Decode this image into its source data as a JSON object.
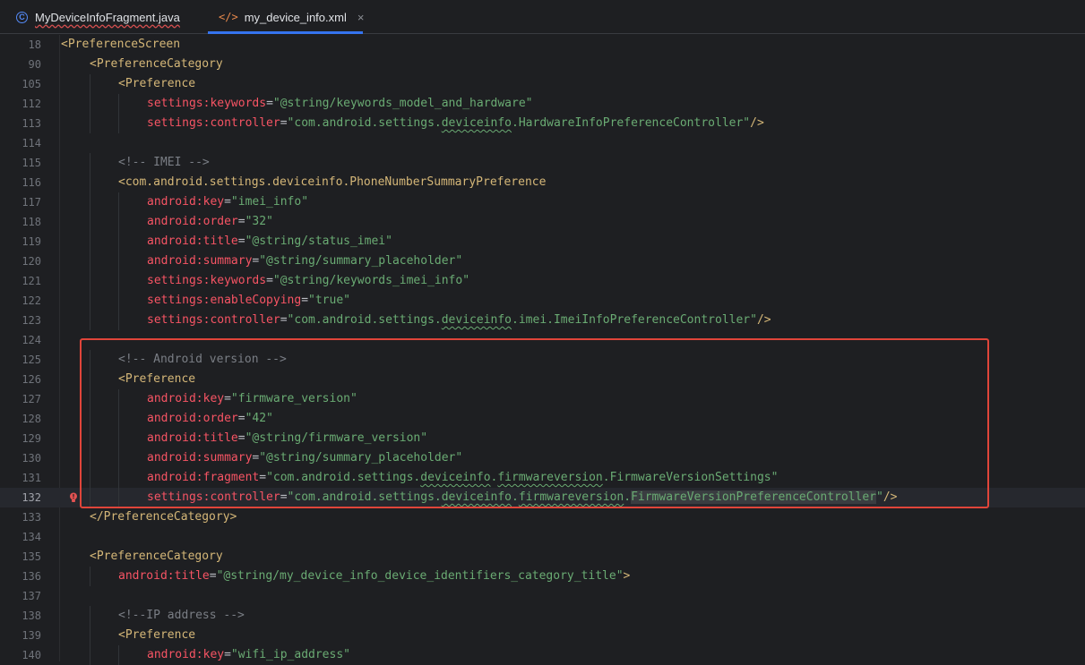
{
  "tabs": [
    {
      "label": "MyDeviceInfoFragment.java",
      "icon": "java-class-icon",
      "active": false
    },
    {
      "label": "my_device_info.xml",
      "icon": "xml-file-icon",
      "active": true,
      "close": "×"
    }
  ],
  "lines": [
    {
      "n": "18",
      "indent": 0,
      "parts": [
        {
          "t": "<PreferenceScreen",
          "c": "tag"
        }
      ]
    },
    {
      "n": "90",
      "indent": 1,
      "parts": [
        {
          "t": "<PreferenceCategory",
          "c": "tag"
        }
      ]
    },
    {
      "n": "105",
      "indent": 2,
      "parts": [
        {
          "t": "<Preference",
          "c": "tag"
        }
      ]
    },
    {
      "n": "112",
      "indent": 3,
      "parts": [
        {
          "t": "settings:keywords",
          "c": "attrname"
        },
        {
          "t": "=",
          "c": "plain"
        },
        {
          "t": "\"@string/keywords_model_and_hardware\"",
          "c": "val"
        }
      ]
    },
    {
      "n": "113",
      "indent": 3,
      "parts": [
        {
          "t": "settings:controller",
          "c": "attrname"
        },
        {
          "t": "=",
          "c": "plain"
        },
        {
          "t": "\"com.android.settings.",
          "c": "val"
        },
        {
          "t": "deviceinfo",
          "c": "val wavy"
        },
        {
          "t": ".HardwareInfoPreferenceController\"",
          "c": "val"
        },
        {
          "t": "/>",
          "c": "tag"
        }
      ]
    },
    {
      "n": "114",
      "indent": 0,
      "parts": []
    },
    {
      "n": "115",
      "indent": 2,
      "parts": [
        {
          "t": "<!-- IMEI -->",
          "c": "cmt"
        }
      ]
    },
    {
      "n": "116",
      "indent": 2,
      "parts": [
        {
          "t": "<com.android.settings.deviceinfo.PhoneNumberSummaryPreference",
          "c": "tag"
        }
      ]
    },
    {
      "n": "117",
      "indent": 3,
      "parts": [
        {
          "t": "android:key",
          "c": "attrname"
        },
        {
          "t": "=",
          "c": "plain"
        },
        {
          "t": "\"imei_info\"",
          "c": "val"
        }
      ]
    },
    {
      "n": "118",
      "indent": 3,
      "parts": [
        {
          "t": "android:order",
          "c": "attrname"
        },
        {
          "t": "=",
          "c": "plain"
        },
        {
          "t": "\"32\"",
          "c": "val"
        }
      ]
    },
    {
      "n": "119",
      "indent": 3,
      "parts": [
        {
          "t": "android:title",
          "c": "attrname"
        },
        {
          "t": "=",
          "c": "plain"
        },
        {
          "t": "\"@string/status_imei\"",
          "c": "val"
        }
      ]
    },
    {
      "n": "120",
      "indent": 3,
      "parts": [
        {
          "t": "android:summary",
          "c": "attrname"
        },
        {
          "t": "=",
          "c": "plain"
        },
        {
          "t": "\"@string/summary_placeholder\"",
          "c": "val"
        }
      ]
    },
    {
      "n": "121",
      "indent": 3,
      "parts": [
        {
          "t": "settings:keywords",
          "c": "attrname"
        },
        {
          "t": "=",
          "c": "plain"
        },
        {
          "t": "\"@string/keywords_imei_info\"",
          "c": "val"
        }
      ]
    },
    {
      "n": "122",
      "indent": 3,
      "parts": [
        {
          "t": "settings:enableCopying",
          "c": "attrname"
        },
        {
          "t": "=",
          "c": "plain"
        },
        {
          "t": "\"true\"",
          "c": "val"
        }
      ]
    },
    {
      "n": "123",
      "indent": 3,
      "parts": [
        {
          "t": "settings:controller",
          "c": "attrname"
        },
        {
          "t": "=",
          "c": "plain"
        },
        {
          "t": "\"com.android.settings.",
          "c": "val"
        },
        {
          "t": "deviceinfo",
          "c": "val wavy"
        },
        {
          "t": ".imei.ImeiInfoPreferenceController\"",
          "c": "val"
        },
        {
          "t": "/>",
          "c": "tag"
        }
      ]
    },
    {
      "n": "124",
      "indent": 0,
      "parts": []
    },
    {
      "n": "125",
      "indent": 2,
      "parts": [
        {
          "t": "<!-- Android version -->",
          "c": "cmt"
        }
      ]
    },
    {
      "n": "126",
      "indent": 2,
      "parts": [
        {
          "t": "<Preference",
          "c": "tag"
        }
      ]
    },
    {
      "n": "127",
      "indent": 3,
      "parts": [
        {
          "t": "android:key",
          "c": "attrname"
        },
        {
          "t": "=",
          "c": "plain"
        },
        {
          "t": "\"firmware_version\"",
          "c": "val"
        }
      ]
    },
    {
      "n": "128",
      "indent": 3,
      "parts": [
        {
          "t": "android:order",
          "c": "attrname"
        },
        {
          "t": "=",
          "c": "plain"
        },
        {
          "t": "\"42\"",
          "c": "val"
        }
      ]
    },
    {
      "n": "129",
      "indent": 3,
      "parts": [
        {
          "t": "android:title",
          "c": "attrname"
        },
        {
          "t": "=",
          "c": "plain"
        },
        {
          "t": "\"@string/firmware_version\"",
          "c": "val"
        }
      ]
    },
    {
      "n": "130",
      "indent": 3,
      "parts": [
        {
          "t": "android:summary",
          "c": "attrname"
        },
        {
          "t": "=",
          "c": "plain"
        },
        {
          "t": "\"@string/summary_placeholder\"",
          "c": "val"
        }
      ]
    },
    {
      "n": "131",
      "indent": 3,
      "parts": [
        {
          "t": "android:fragment",
          "c": "attrname"
        },
        {
          "t": "=",
          "c": "plain"
        },
        {
          "t": "\"com.android.settings.",
          "c": "val"
        },
        {
          "t": "deviceinfo",
          "c": "val wavy"
        },
        {
          "t": ".",
          "c": "val"
        },
        {
          "t": "firmwareversion",
          "c": "val wavy"
        },
        {
          "t": ".FirmwareVersionSettings\"",
          "c": "val"
        }
      ]
    },
    {
      "n": "132",
      "indent": 3,
      "current": true,
      "bulb": true,
      "parts": [
        {
          "t": "settings:controller",
          "c": "attrname"
        },
        {
          "t": "=",
          "c": "plain"
        },
        {
          "t": "\"com.android.settings.",
          "c": "val"
        },
        {
          "t": "deviceinfo",
          "c": "val wavy"
        },
        {
          "t": ".",
          "c": "val"
        },
        {
          "t": "firmwareversion",
          "c": "val wavy"
        },
        {
          "t": ".",
          "c": "val"
        },
        {
          "t": "FirmwareVersionPreferenceController",
          "c": "val hl"
        },
        {
          "t": "\"",
          "c": "val"
        },
        {
          "t": "/>",
          "c": "tag"
        }
      ]
    },
    {
      "n": "133",
      "indent": 1,
      "parts": [
        {
          "t": "</PreferenceCategory>",
          "c": "tag"
        }
      ]
    },
    {
      "n": "134",
      "indent": 0,
      "parts": []
    },
    {
      "n": "135",
      "indent": 1,
      "parts": [
        {
          "t": "<PreferenceCategory",
          "c": "tag"
        }
      ]
    },
    {
      "n": "136",
      "indent": 2,
      "parts": [
        {
          "t": "android:title",
          "c": "attrname"
        },
        {
          "t": "=",
          "c": "plain"
        },
        {
          "t": "\"@string/my_device_info_device_identifiers_category_title\"",
          "c": "val"
        },
        {
          "t": ">",
          "c": "tag"
        }
      ]
    },
    {
      "n": "137",
      "indent": 0,
      "parts": []
    },
    {
      "n": "138",
      "indent": 2,
      "parts": [
        {
          "t": "<!--IP address -->",
          "c": "cmt"
        }
      ]
    },
    {
      "n": "139",
      "indent": 2,
      "parts": [
        {
          "t": "<Preference",
          "c": "tag"
        }
      ]
    },
    {
      "n": "140",
      "indent": 3,
      "parts": [
        {
          "t": "android:key",
          "c": "attrname"
        },
        {
          "t": "=",
          "c": "plain"
        },
        {
          "t": "\"wifi_ip_address\"",
          "c": "val"
        }
      ]
    }
  ],
  "colors": {
    "tag": "#d5b778",
    "attribute": "#f75464",
    "value": "#6aab73",
    "comment": "#7a7e85",
    "highlight_box": "#e0453a",
    "tab_accent": "#3574f0"
  }
}
